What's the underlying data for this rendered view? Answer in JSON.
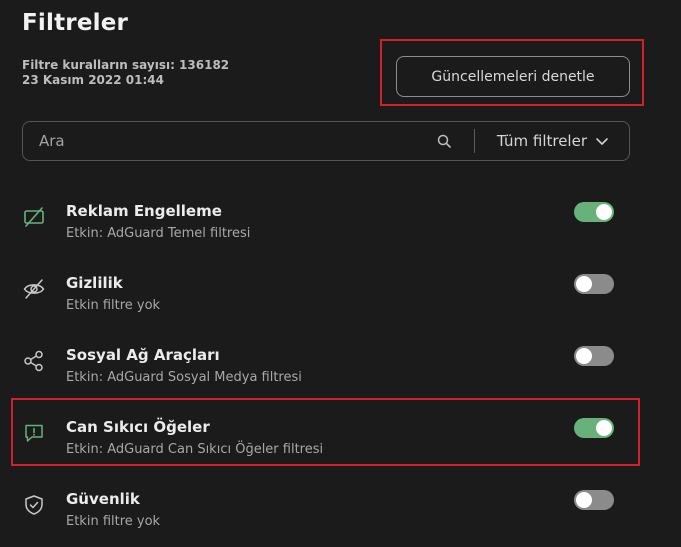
{
  "page": {
    "title": "Filtreler",
    "rule_count_text": "Filtre kuralların sayısı: 136182",
    "date_text": "23 Kasım 2022 01:44",
    "update_button_label": "Güncellemeleri denetle"
  },
  "search": {
    "placeholder": "Ara",
    "filter_select_label": "Tüm filtreler"
  },
  "colors": {
    "background": "#1b1b1b",
    "accent_green": "#67b279",
    "toggle_off": "#8b8b8b",
    "highlight_red": "#d62028"
  },
  "filters": [
    {
      "icon": "ad-block-icon",
      "title": "Reklam Engelleme",
      "subtitle": "Etkin: AdGuard Temel filtresi",
      "enabled": true
    },
    {
      "icon": "eye-off-icon",
      "title": "Gizlilik",
      "subtitle": "Etkin filtre yok",
      "enabled": false
    },
    {
      "icon": "share-icon",
      "title": "Sosyal Ağ Araçları",
      "subtitle": "Etkin: AdGuard Sosyal Medya filtresi",
      "enabled": false
    },
    {
      "icon": "message-alert-icon",
      "title": "Can Sıkıcı Öğeler",
      "subtitle": "Etkin: AdGuard Can Sıkıcı Öğeler filtresi",
      "enabled": true
    },
    {
      "icon": "shield-icon",
      "title": "Güvenlik",
      "subtitle": "Etkin filtre yok",
      "enabled": false
    }
  ]
}
